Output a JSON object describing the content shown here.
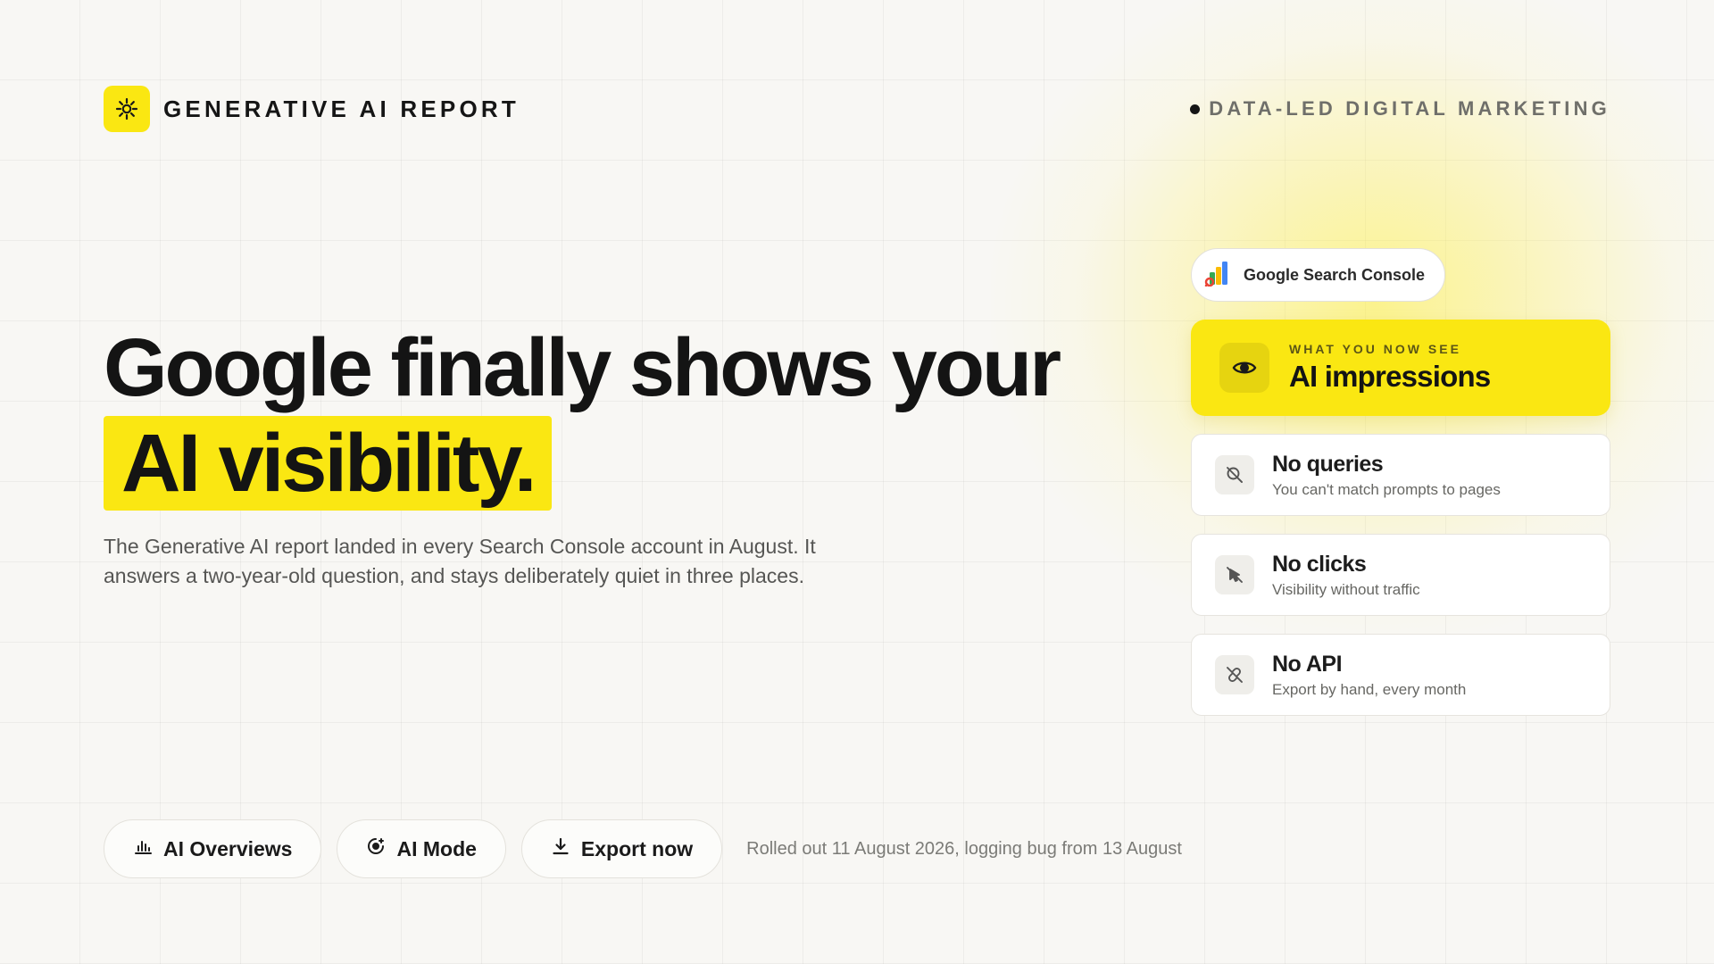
{
  "brand": {
    "name": "GENERATIVE AI REPORT",
    "logo_icon": "sun-gear-icon",
    "accent": "#fae712"
  },
  "tagline": "DATA-LED DIGITAL MARKETING",
  "hero": {
    "line1": "Google finally shows your",
    "highlight": "AI visibility.",
    "intro": "The Generative AI report landed in every Search Console account in August. It answers a two-year-old question, and stays deliberately quiet in three places."
  },
  "side": {
    "chip": {
      "label": "Google Search Console",
      "icon": "search-console-logo-icon"
    },
    "now_see": {
      "eyebrow": "WHAT YOU NOW SEE",
      "title": "AI impressions",
      "icon": "eye-icon"
    },
    "limits": [
      {
        "title": "No queries",
        "subtitle": "You can't match prompts to pages",
        "icon": "search-off-icon"
      },
      {
        "title": "No clicks",
        "subtitle": "Visibility without traffic",
        "icon": "pointer-off-icon"
      },
      {
        "title": "No API",
        "subtitle": "Export by hand, every month",
        "icon": "link-off-icon"
      }
    ]
  },
  "actions": [
    {
      "label": "AI Overviews",
      "icon": "bar-chart-icon"
    },
    {
      "label": "AI Mode",
      "icon": "sparkle-circle-icon"
    },
    {
      "label": "Export now",
      "icon": "download-icon"
    }
  ],
  "rollout_note": "Rolled out 11 August 2026, logging bug from 13 August"
}
